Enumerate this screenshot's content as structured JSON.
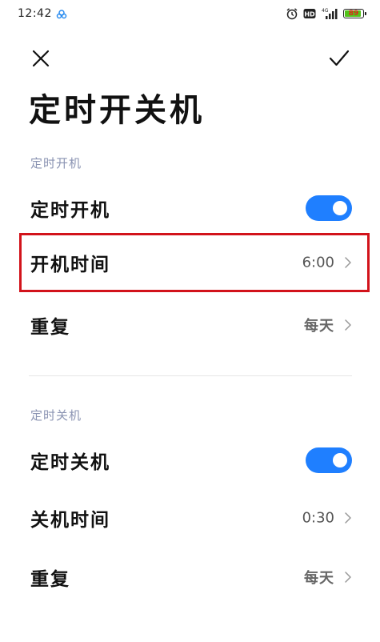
{
  "status_bar": {
    "time": "12:42",
    "battery": "89",
    "network_label": "4G"
  },
  "header": {
    "title": "定时开关机"
  },
  "sections": [
    {
      "header": "定时开机",
      "toggle_label": "定时开机",
      "toggle_on": true,
      "time_label": "开机时间",
      "time_value": "6:00",
      "repeat_label": "重复",
      "repeat_value": "每天"
    },
    {
      "header": "定时关机",
      "toggle_label": "定时关机",
      "toggle_on": true,
      "time_label": "关机时间",
      "time_value": "0:30",
      "repeat_label": "重复",
      "repeat_value": "每天"
    }
  ],
  "colors": {
    "accent": "#1f7fff",
    "highlight": "#d2131b",
    "section_header": "#8a93b2",
    "battery_fill": "#52c41a"
  },
  "icons": {
    "close": "close-icon",
    "confirm": "check-icon",
    "chevron": "chevron-right-icon",
    "alarm": "alarm-icon",
    "hd": "hd-icon",
    "signal": "signal-icon",
    "battery": "battery-icon",
    "cloud": "cloud-icon"
  }
}
